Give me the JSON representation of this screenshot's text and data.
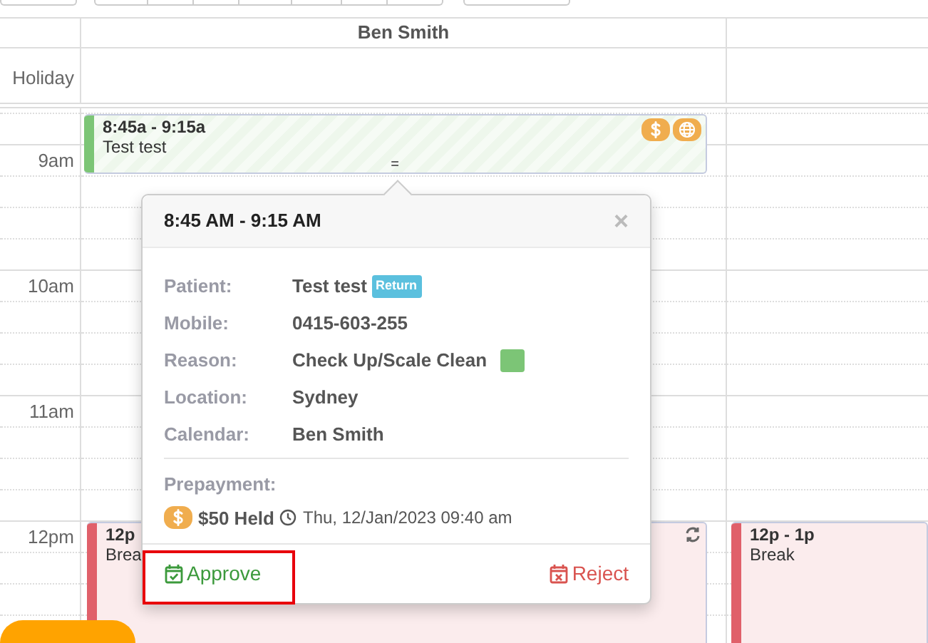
{
  "calendar": {
    "resource": "Ben Smith",
    "all_day_label": "Holiday",
    "time_labels": [
      "9am",
      "10am",
      "11am",
      "12pm"
    ],
    "events": [
      {
        "kind": "appointment",
        "time": "8:45a - 9:15a",
        "title": "Test test",
        "color": "#7cc576",
        "resize_handle": "="
      },
      {
        "kind": "break",
        "time": "12p",
        "title": "Brea",
        "color": "#e0606a",
        "recurring": true
      },
      {
        "kind": "break",
        "time": "12p - 1p",
        "title": "Break",
        "color": "#e0606a"
      }
    ]
  },
  "popover": {
    "title": "8:45 AM - 9:15 AM",
    "close": "×",
    "fields": [
      {
        "label": "Patient:",
        "value": "Test test",
        "tag": "Return"
      },
      {
        "label": "Mobile:",
        "value": "0415-603-255"
      },
      {
        "label": "Reason:",
        "value": "Check Up/Scale Clean",
        "color": "#7cc576"
      },
      {
        "label": "Location:",
        "value": "Sydney"
      },
      {
        "label": "Calendar:",
        "value": "Ben Smith"
      }
    ],
    "prepayment": {
      "label": "Prepayment:",
      "amount": "$50 Held",
      "time": "Thu, 12/Jan/2023 09:40 am"
    },
    "actions": [
      {
        "kind": "approve",
        "label": "Approve",
        "highlighted": true
      },
      {
        "kind": "reject",
        "label": "Reject"
      }
    ]
  }
}
